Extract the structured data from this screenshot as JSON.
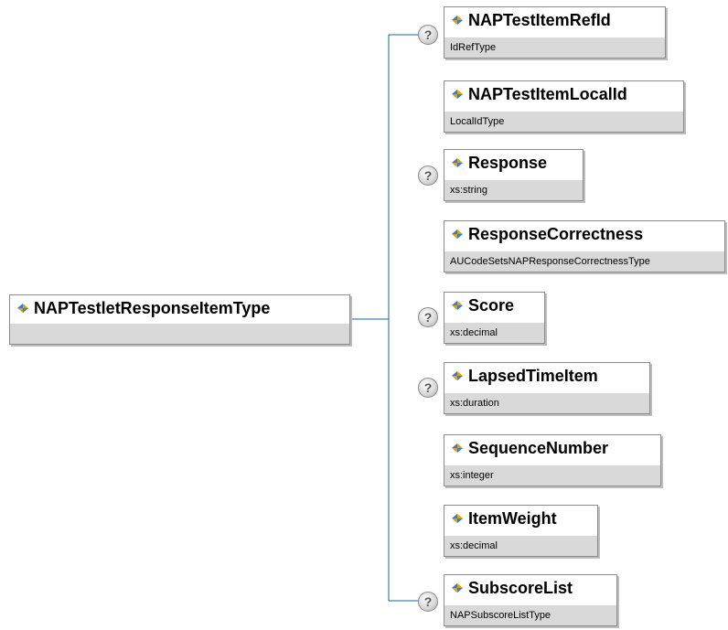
{
  "root": {
    "name": "NAPTestletResponseItemType",
    "type": ""
  },
  "children": [
    {
      "name": "NAPTestItemRefId",
      "type": "IdRefType",
      "optional": true
    },
    {
      "name": "NAPTestItemLocalId",
      "type": "LocalIdType",
      "optional": false
    },
    {
      "name": "Response",
      "type": "xs:string",
      "optional": true
    },
    {
      "name": "ResponseCorrectness",
      "type": "AUCodeSetsNAPResponseCorrectnessType",
      "optional": false
    },
    {
      "name": "Score",
      "type": "xs:decimal",
      "optional": true
    },
    {
      "name": "LapsedTimeItem",
      "type": "xs:duration",
      "optional": true
    },
    {
      "name": "SequenceNumber",
      "type": "xs:integer",
      "optional": false
    },
    {
      "name": "ItemWeight",
      "type": "xs:decimal",
      "optional": false
    },
    {
      "name": "SubscoreList",
      "type": "NAPSubscoreListType",
      "optional": true
    }
  ],
  "optional_marker": "?",
  "colors": {
    "line": "#1f5fa0",
    "type_band": "#d9d9d9",
    "border": "#8c8c8c",
    "icon_blue": "#2f7fd6",
    "icon_orange": "#e8a000"
  }
}
